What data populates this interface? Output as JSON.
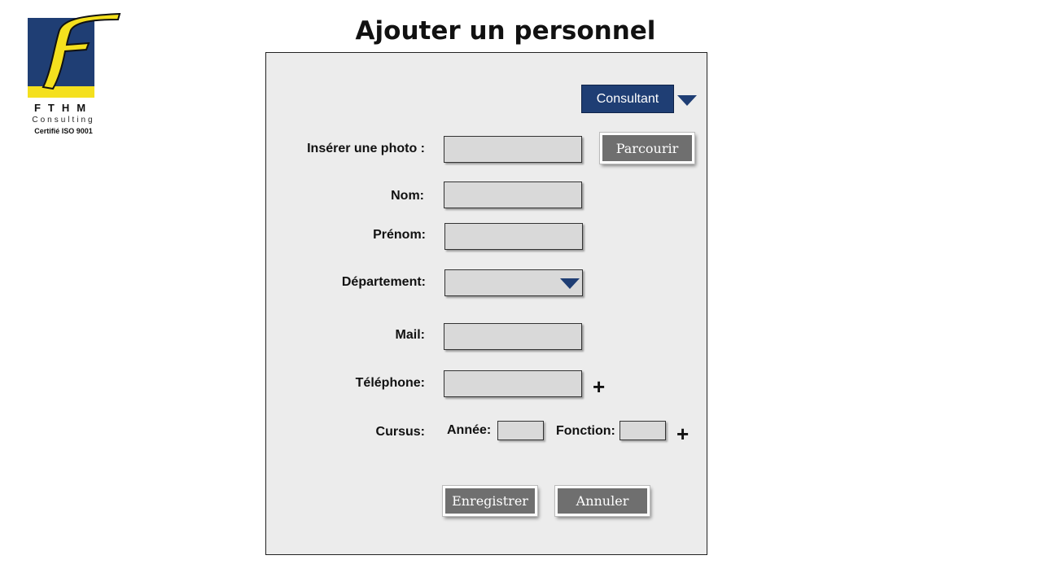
{
  "logo": {
    "name": "FTHM",
    "subtitle": "Consulting",
    "certification": "Certifié ISO 9001"
  },
  "page_title": "Ajouter un personnel",
  "type_select": {
    "value": "Consultant"
  },
  "form": {
    "photo_label": "Insérer une photo :",
    "browse_label": "Parcourir",
    "nom_label": "Nom:",
    "prenom_label": "Prénom:",
    "departement_label": "Département:",
    "mail_label": "Mail:",
    "telephone_label": "Téléphone:",
    "cursus_label": "Cursus:",
    "annee_label": "Année:",
    "fonction_label": "Fonction:",
    "plus_symbol": "+"
  },
  "actions": {
    "save_label": "Enregistrer",
    "cancel_label": "Annuler"
  },
  "colors": {
    "accent": "#1f3e74",
    "logo_yellow": "#f4e01e",
    "button_gray": "#6f6f6f",
    "panel_bg": "#ececec"
  },
  "icons": [
    "logo-f-mark",
    "dropdown-triangle-icon",
    "add-plus-icon"
  ]
}
